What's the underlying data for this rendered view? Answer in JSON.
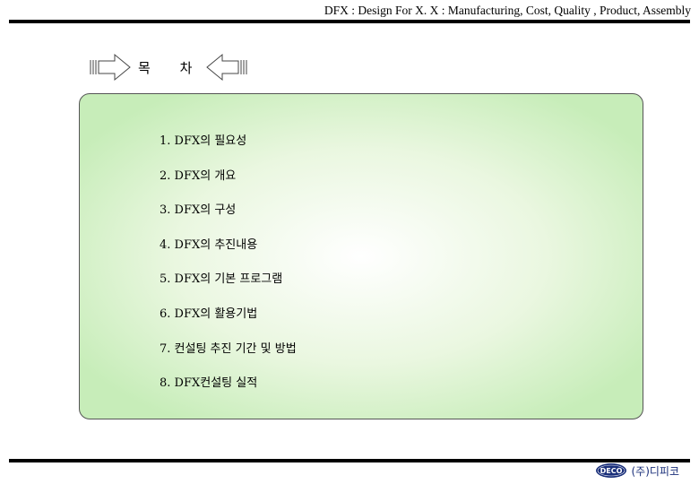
{
  "header": {
    "title": "DFX : Design For X. X : Manufacturing, Cost, Quality , Product, Assembly"
  },
  "toc": {
    "title": "목 차",
    "items": [
      "1. DFX의 필요성",
      "2. DFX의 개요",
      "3. DFX의 구성",
      "4. DFX의 추진내용",
      "5. DFX의 기본 프로그램",
      "6. DFX의 활용기법",
      "7. 컨설팅 추진 기간 및 방법",
      "8. DFX컨설팅 실적"
    ]
  },
  "footer": {
    "logo_mark_text": "DECO",
    "company": "(주)디피코"
  },
  "colors": {
    "box_fill": "#c7edb9",
    "logo_blue": "#1a2f7a"
  }
}
